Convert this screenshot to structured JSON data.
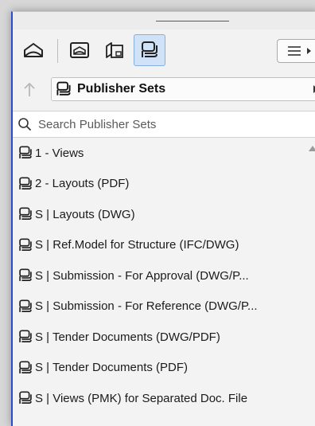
{
  "toolbar": {
    "buttons": [
      {
        "icon": "project-map-icon"
      },
      {
        "icon": "view-map-icon"
      },
      {
        "icon": "layout-book-icon"
      },
      {
        "icon": "publisher-sets-icon",
        "selected": true
      }
    ],
    "menu_icon": "hamburger-menu-icon"
  },
  "navigator": {
    "current_map": "Publisher Sets",
    "current_map_icon": "publisher-sets-icon"
  },
  "search": {
    "placeholder": "Search Publisher Sets"
  },
  "publisher_sets": [
    {
      "label": "1 - Views"
    },
    {
      "label": "2 - Layouts (PDF)"
    },
    {
      "label": "S | Layouts (DWG)"
    },
    {
      "label": "S | Ref.Model for Structure (IFC/DWG)"
    },
    {
      "label": "S | Submission - For Approval (DWG/P..."
    },
    {
      "label": "S | Submission - For Reference (DWG/P..."
    },
    {
      "label": "S | Tender Documents (DWG/PDF)"
    },
    {
      "label": "S | Tender Documents (PDF)"
    },
    {
      "label": "S | Views (PMK) for Separated Doc. File"
    }
  ],
  "colors": {
    "selection_fill": "#cfe2f7",
    "selection_border": "#86aee0",
    "panel_left_edge": "#2a4bd0"
  }
}
